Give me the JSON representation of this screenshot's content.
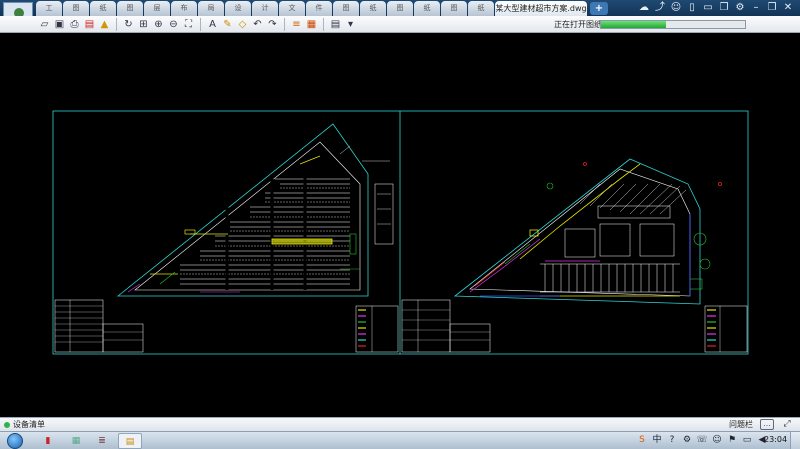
{
  "tabs": {
    "items": [
      "工",
      "图",
      "纸",
      "图",
      "层",
      "布",
      "局",
      "设",
      "计",
      "文",
      "件",
      "图",
      "纸",
      "图",
      "纸",
      "图",
      "纸"
    ],
    "active_title": "某大型建材超市方案.dwg",
    "new_tab": "+"
  },
  "system": {
    "icons": [
      "cloud-icon",
      "share-icon",
      "user-icon",
      "phone-icon",
      "chat-icon",
      "copy-icon",
      "settings-icon",
      "minimize-icon",
      "restore-icon",
      "close-icon"
    ]
  },
  "toolbar": {
    "opening_text": "正在打开图纸",
    "progress": 0.45,
    "icons": [
      "open-icon",
      "save-icon",
      "print-icon",
      "export-pdf-icon",
      "lock-icon",
      "rotate-icon",
      "zoom-extents-icon",
      "zoom-in-icon",
      "zoom-out-icon",
      "pan-icon",
      "text-icon",
      "pencil-icon",
      "erase-icon",
      "undo-icon",
      "redo-icon",
      "layers-icon",
      "measure-icon",
      "layout-icon",
      "more-icon"
    ]
  },
  "status": {
    "left_label": "设备清单",
    "right_label": "问题栏"
  },
  "taskbar": {
    "clock": "23:04"
  },
  "colors": {
    "frame": "#2fd4d4",
    "wall": "#ffffff",
    "yellow": "#e6e600",
    "green": "#29c229",
    "magenta": "#e633e6",
    "red": "#e62222",
    "blue": "#3355ff"
  }
}
